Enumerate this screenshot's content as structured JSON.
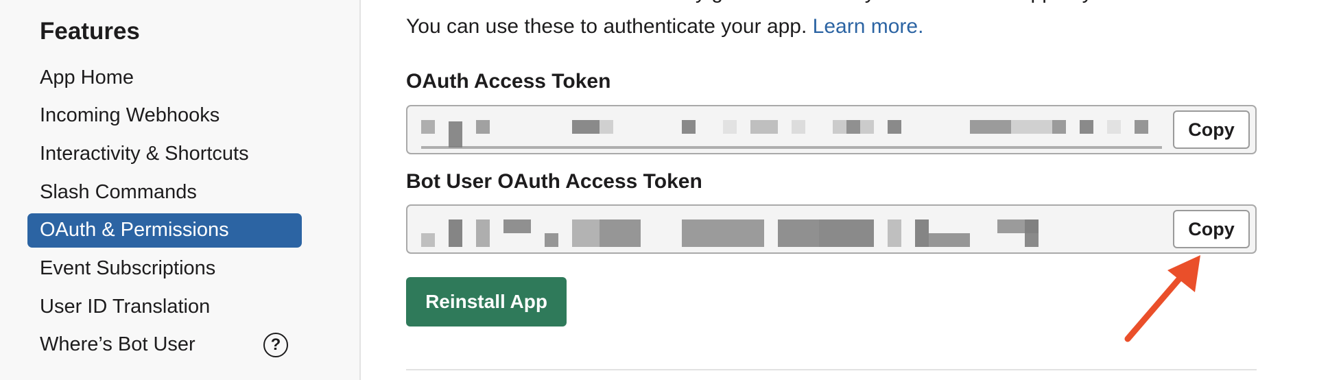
{
  "sidebar": {
    "heading": "Features",
    "items": [
      {
        "label": "App Home",
        "active": false
      },
      {
        "label": "Incoming Webhooks",
        "active": false
      },
      {
        "label": "Interactivity & Shortcuts",
        "active": false
      },
      {
        "label": "Slash Commands",
        "active": false
      },
      {
        "label": "OAuth & Permissions",
        "active": true
      },
      {
        "label": "Event Subscriptions",
        "active": false
      },
      {
        "label": "User ID Translation",
        "active": false
      },
      {
        "label": "Where’s Bot User",
        "active": false,
        "icon": "question-circle-icon"
      }
    ],
    "help_glyph": "?"
  },
  "main": {
    "intro_line_1": "These tokens were automatically generated when you installed the app to your team.",
    "intro_line_2": "You can use these to authenticate your app.",
    "learn_more": "Learn more.",
    "oauth_token": {
      "label": "OAuth Access Token",
      "copy_label": "Copy"
    },
    "bot_token": {
      "label": "Bot User OAuth Access Token",
      "copy_label": "Copy"
    },
    "reinstall_label": "Reinstall App"
  },
  "colors": {
    "accent": "#2c64a3",
    "reinstall": "#2f7a5a",
    "annotation_arrow": "#ea4f2a"
  }
}
